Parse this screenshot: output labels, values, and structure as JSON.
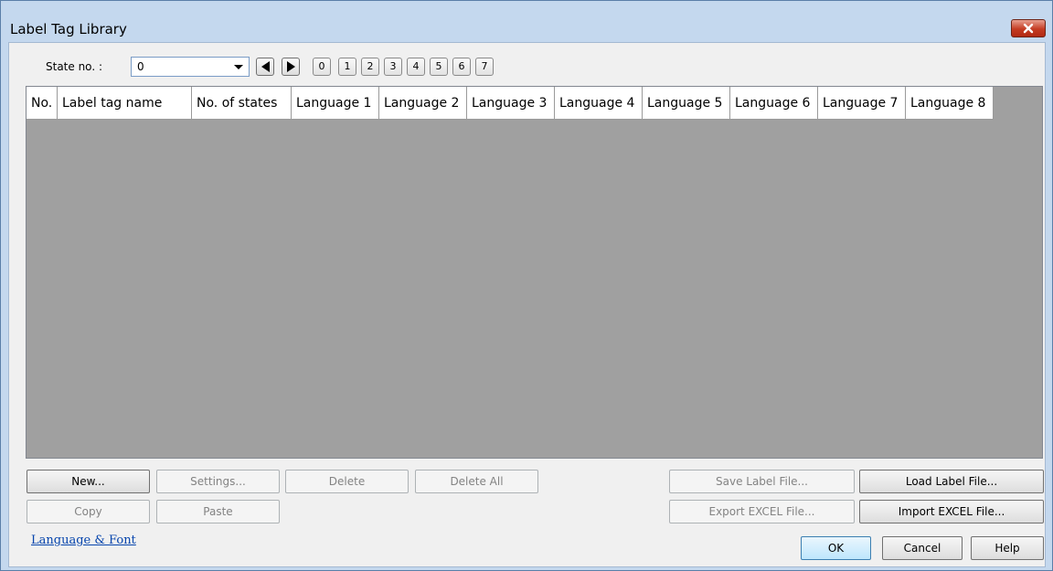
{
  "window": {
    "title": "Label Tag Library"
  },
  "toolbar": {
    "state_label": "State no. :",
    "state_value": "0",
    "state_buttons": [
      "0",
      "1",
      "2",
      "3",
      "4",
      "5",
      "6",
      "7"
    ]
  },
  "table": {
    "columns": [
      "No.",
      "Label tag name",
      "No. of states",
      "Language 1",
      "Language 2",
      "Language 3",
      "Language 4",
      "Language 5",
      "Language 6",
      "Language 7",
      "Language 8"
    ],
    "rows": []
  },
  "buttons": {
    "new": "New...",
    "settings": "Settings...",
    "delete": "Delete",
    "delete_all": "Delete All",
    "copy": "Copy",
    "paste": "Paste",
    "save_label_file": "Save Label File...",
    "load_label_file": "Load Label File...",
    "export_excel": "Export EXCEL File...",
    "import_excel": "Import EXCEL File...",
    "ok": "OK",
    "cancel": "Cancel",
    "help": "Help"
  },
  "links": {
    "language_font": "Language & Font"
  },
  "colors": {
    "title_bar": "#c4d8ee",
    "client": "#f0f0f0",
    "grid_background": "#a0a0a0",
    "close_button": "#c43b22",
    "link": "#0645ad"
  },
  "icons": {
    "close": "close-icon",
    "combo_dropdown": "chevron-down-icon",
    "prev": "triangle-left-icon",
    "next": "triangle-right-icon"
  }
}
